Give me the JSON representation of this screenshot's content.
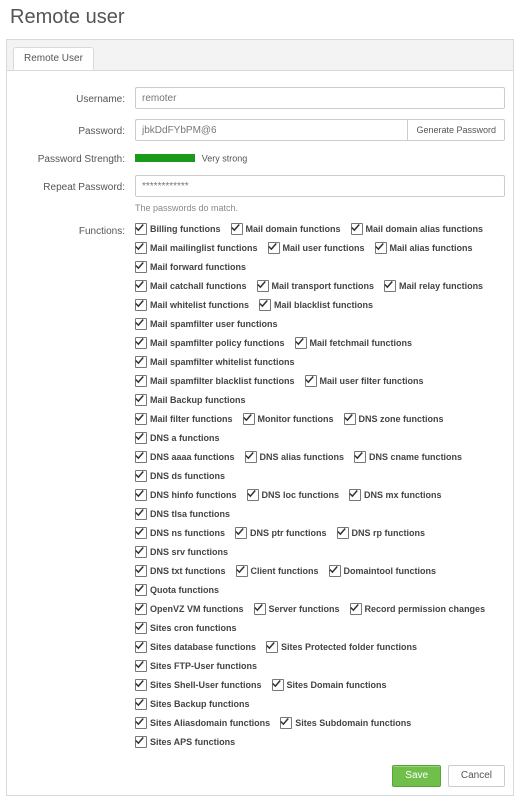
{
  "page": {
    "title": "Remote user"
  },
  "tabs": {
    "remote_user": "Remote User"
  },
  "form": {
    "labels": {
      "username": "Username:",
      "password": "Password:",
      "strength": "Password Strength:",
      "repeat": "Repeat Password:",
      "functions": "Functions:"
    },
    "username": "remoter",
    "password": "jbkDdFYbPM@6",
    "gen_button": "Generate Password",
    "strength_text": "Very strong",
    "repeat_password": "************",
    "match_hint": "The passwords do match."
  },
  "functions": [
    [
      "Billing functions",
      "Mail domain functions",
      "Mail domain alias functions"
    ],
    [
      "Mail mailinglist functions",
      "Mail user functions",
      "Mail alias functions",
      "Mail forward functions"
    ],
    [
      "Mail catchall functions",
      "Mail transport functions",
      "Mail relay functions"
    ],
    [
      "Mail whitelist functions",
      "Mail blacklist functions",
      "Mail spamfilter user functions"
    ],
    [
      "Mail spamfilter policy functions",
      "Mail fetchmail functions",
      "Mail spamfilter whitelist functions"
    ],
    [
      "Mail spamfilter blacklist functions",
      "Mail user filter functions",
      "Mail Backup functions"
    ],
    [
      "Mail filter functions",
      "Monitor functions",
      "DNS zone functions",
      "DNS a functions"
    ],
    [
      "DNS aaaa functions",
      "DNS alias functions",
      "DNS cname functions",
      "DNS ds functions"
    ],
    [
      "DNS hinfo functions",
      "DNS loc functions",
      "DNS mx functions",
      "DNS tlsa functions"
    ],
    [
      "DNS ns functions",
      "DNS ptr functions",
      "DNS rp functions",
      "DNS srv functions"
    ],
    [
      "DNS txt functions",
      "Client functions",
      "Domaintool functions",
      "Quota functions"
    ],
    [
      "OpenVZ VM functions",
      "Server functions",
      "Record permission changes",
      "Sites cron functions"
    ],
    [
      "Sites database functions",
      "Sites Protected folder functions",
      "Sites FTP-User functions"
    ],
    [
      "Sites Shell-User functions",
      "Sites Domain functions",
      "Sites Backup functions"
    ],
    [
      "Sites Aliasdomain functions",
      "Sites Subdomain functions",
      "Sites APS functions"
    ]
  ],
  "buttons": {
    "save": "Save",
    "cancel": "Cancel"
  }
}
